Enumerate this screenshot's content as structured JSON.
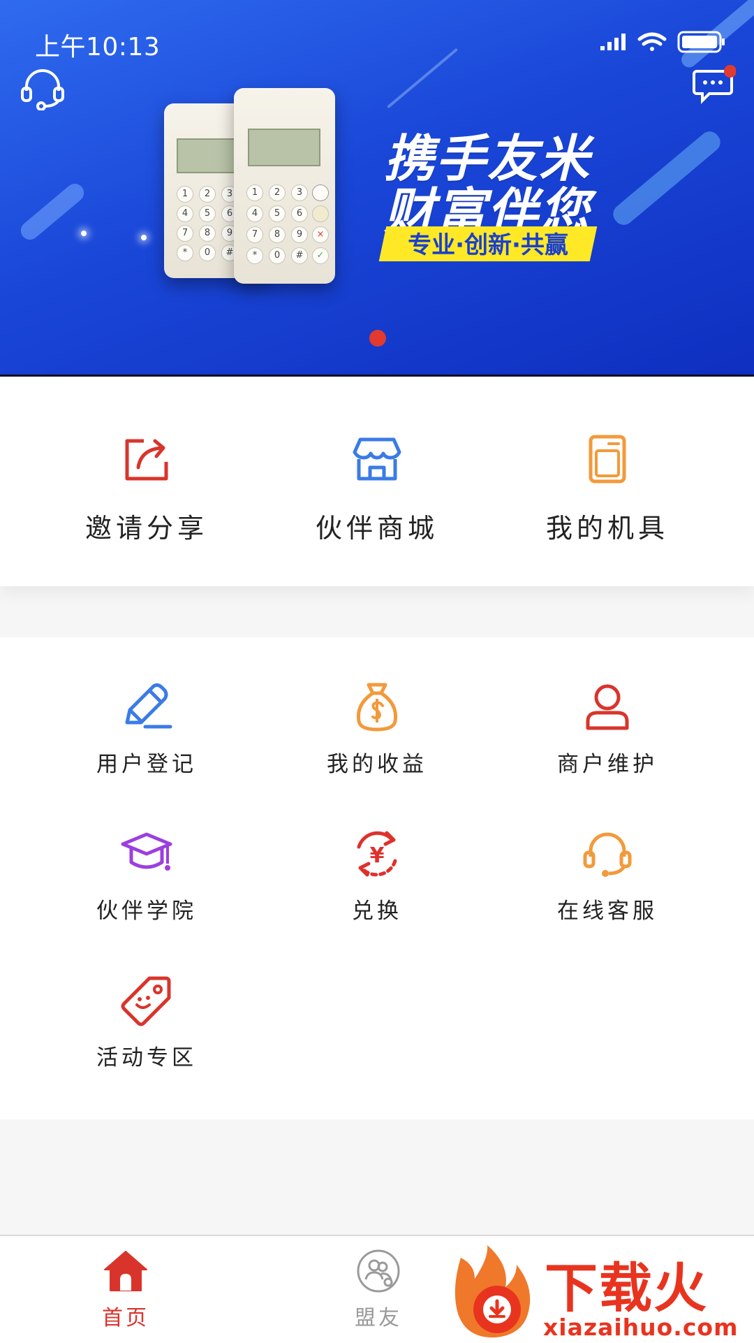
{
  "status_bar": {
    "time": "上午10:13"
  },
  "banner": {
    "slogan_line1": "携手友米",
    "slogan_line2": "财富伴您",
    "tagline": "专业·创新·共赢",
    "slide_count": 1,
    "active_slide": 1,
    "device_keys": [
      "1",
      "2",
      "3",
      "4",
      "5",
      "6",
      "7",
      "8",
      "9",
      "*",
      "0",
      "#"
    ]
  },
  "header": {
    "left_icon": "headset-icon",
    "right_icon": "message-icon",
    "message_badge": true
  },
  "quick_menu": [
    {
      "label": "邀请分享",
      "icon": "share-icon",
      "color": "#d9342b"
    },
    {
      "label": "伙伴商城",
      "icon": "store-icon",
      "color": "#3a7be6"
    },
    {
      "label": "我的机具",
      "icon": "device-icon",
      "color": "#f29a3b"
    }
  ],
  "grid": [
    {
      "label": "用户登记",
      "icon": "pencil-icon",
      "color": "#3a7be6"
    },
    {
      "label": "我的收益",
      "icon": "money-bag-icon",
      "color": "#f29a3b"
    },
    {
      "label": "商户维护",
      "icon": "user-icon",
      "color": "#d9342b"
    },
    {
      "label": "伙伴学院",
      "icon": "graduation-cap-icon",
      "color": "#9b3fe0"
    },
    {
      "label": "兑换",
      "icon": "exchange-yen-icon",
      "color": "#e0302a"
    },
    {
      "label": "在线客服",
      "icon": "headset-icon",
      "color": "#f29a3b"
    },
    {
      "label": "活动专区",
      "icon": "tag-icon",
      "color": "#d9342b"
    }
  ],
  "tabbar": [
    {
      "label": "首页",
      "icon": "home-icon",
      "active": true,
      "color": "#d9342b"
    },
    {
      "label": "盟友",
      "icon": "friends-icon",
      "active": false,
      "color": "#9a9a9a"
    }
  ],
  "watermark": {
    "text": "下载火",
    "url": "xiazaihuo.com"
  }
}
